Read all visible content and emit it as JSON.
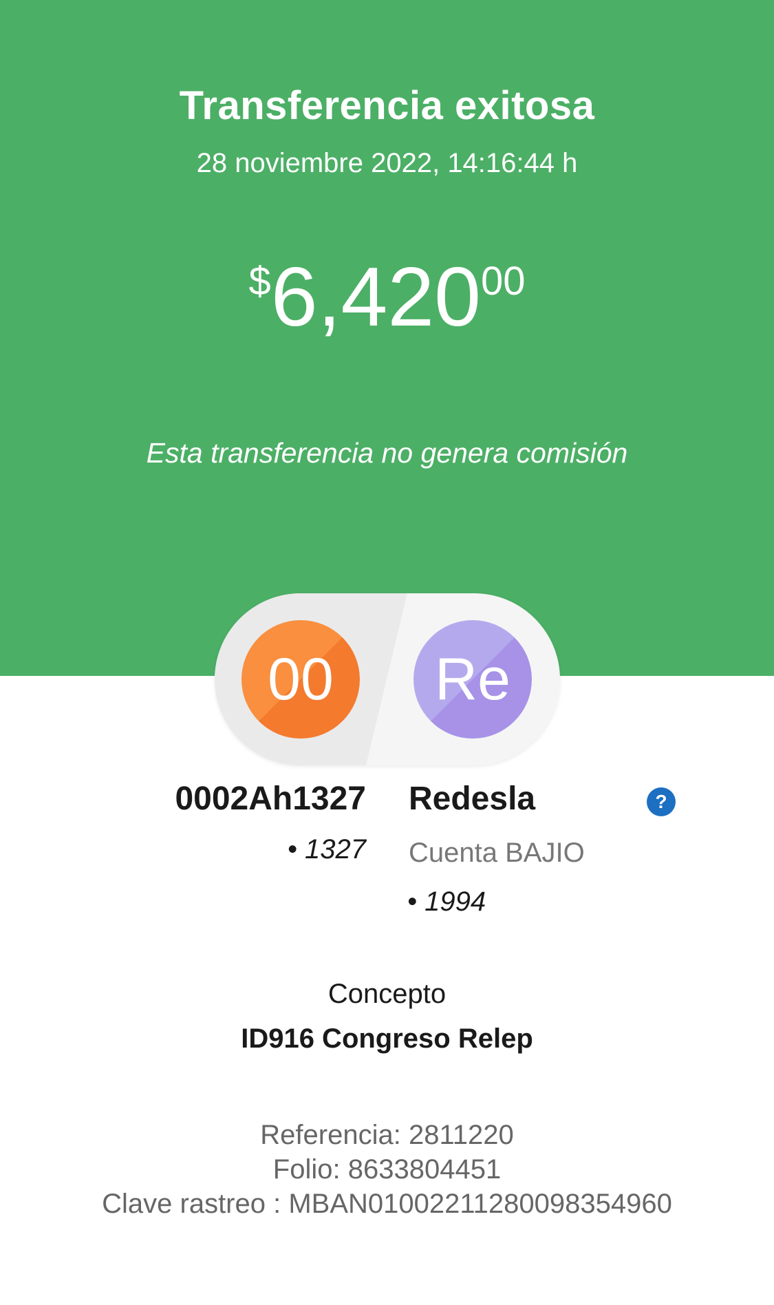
{
  "header": {
    "title": "Transferencia exitosa",
    "datetime": "28 noviembre 2022, 14:16:44 h",
    "amount": {
      "currency_symbol": "$",
      "integer": "6,420",
      "cents": "00"
    },
    "commission_note": "Esta transferencia no genera comisión"
  },
  "colors": {
    "header_bg": "#4caf66",
    "from_avatar": "#f47a2e",
    "to_avatar": "#a792e8",
    "help_icon": "#1c6fc1"
  },
  "from": {
    "avatar_initials": "00",
    "name": "0002Ah1327",
    "account": "• 1327"
  },
  "to": {
    "avatar_initials": "Re",
    "name": "Redesla",
    "bank": "Cuenta BAJIO",
    "account": "• 1994",
    "help_icon": "question-circle-icon",
    "help_glyph": "?"
  },
  "concepto": {
    "label": "Concepto",
    "value": "ID916 Congreso Relep"
  },
  "details": {
    "referencia": "Referencia: 2811220",
    "folio": "Folio: 8633804451",
    "clave_rastreo": "Clave rastreo : MBAN01002211280098354960"
  }
}
